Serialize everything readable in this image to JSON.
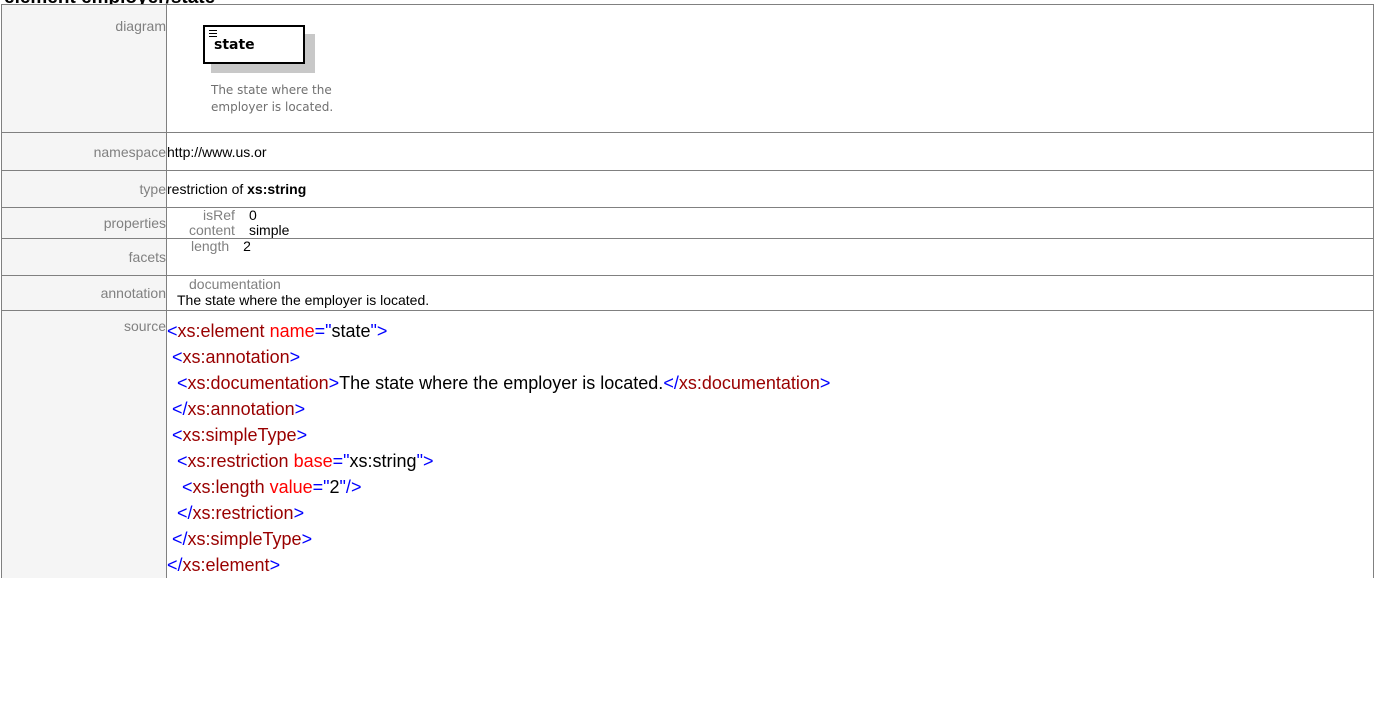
{
  "page": {
    "heading": "element employer/state"
  },
  "rows": {
    "diagram": {
      "label": "diagram",
      "element_name": "state",
      "element_description_line1": "The state where the",
      "element_description_line2": "employer is located."
    },
    "namespace": {
      "label": "namespace",
      "value": "http://www.us.or"
    },
    "type": {
      "label": "type",
      "prefix": "restriction of ",
      "base": "xs:string"
    },
    "properties": {
      "label": "properties",
      "items": [
        {
          "key": "isRef",
          "value": "0"
        },
        {
          "key": "content",
          "value": "simple"
        }
      ]
    },
    "facets": {
      "label": "facets",
      "items": [
        {
          "key": "length",
          "value": "2"
        }
      ]
    },
    "annotation": {
      "label": "annotation",
      "heading": "documentation",
      "text": "The state where the employer is located."
    },
    "source": {
      "label": "source",
      "lines": [
        {
          "indent": "",
          "parts": [
            [
              "t",
              "<"
            ],
            [
              "tn",
              "xs:element"
            ],
            [
              "tx",
              " "
            ],
            [
              "an",
              "name"
            ],
            [
              "t",
              "=\""
            ],
            [
              "tx",
              "state"
            ],
            [
              "t",
              "\">"
            ]
          ]
        },
        {
          "indent": " ",
          "parts": [
            [
              "t",
              "<"
            ],
            [
              "tn",
              "xs:annotation"
            ],
            [
              "t",
              ">"
            ]
          ]
        },
        {
          "indent": "  ",
          "parts": [
            [
              "t",
              "<"
            ],
            [
              "tn",
              "xs:documentation"
            ],
            [
              "t",
              ">"
            ],
            [
              "tx",
              "The state where the employer is located."
            ],
            [
              "t",
              "</"
            ],
            [
              "tn",
              "xs:documentation"
            ],
            [
              "t",
              ">"
            ]
          ]
        },
        {
          "indent": " ",
          "parts": [
            [
              "t",
              "</"
            ],
            [
              "tn",
              "xs:annotation"
            ],
            [
              "t",
              ">"
            ]
          ]
        },
        {
          "indent": " ",
          "parts": [
            [
              "t",
              "<"
            ],
            [
              "tn",
              "xs:simpleType"
            ],
            [
              "t",
              ">"
            ]
          ]
        },
        {
          "indent": "  ",
          "parts": [
            [
              "t",
              "<"
            ],
            [
              "tn",
              "xs:restriction"
            ],
            [
              "tx",
              " "
            ],
            [
              "an",
              "base"
            ],
            [
              "t",
              "=\""
            ],
            [
              "tx",
              "xs:string"
            ],
            [
              "t",
              "\">"
            ]
          ]
        },
        {
          "indent": "   ",
          "parts": [
            [
              "t",
              "<"
            ],
            [
              "tn",
              "xs:length"
            ],
            [
              "tx",
              " "
            ],
            [
              "an",
              "value"
            ],
            [
              "t",
              "=\""
            ],
            [
              "tx",
              "2"
            ],
            [
              "t",
              "\"/>"
            ]
          ]
        },
        {
          "indent": "  ",
          "parts": [
            [
              "t",
              "</"
            ],
            [
              "tn",
              "xs:restriction"
            ],
            [
              "t",
              ">"
            ]
          ]
        },
        {
          "indent": " ",
          "parts": [
            [
              "t",
              "</"
            ],
            [
              "tn",
              "xs:simpleType"
            ],
            [
              "t",
              ">"
            ]
          ]
        },
        {
          "indent": "",
          "parts": [
            [
              "t",
              "</"
            ],
            [
              "tn",
              "xs:element"
            ],
            [
              "t",
              ">"
            ]
          ]
        }
      ]
    }
  },
  "colors": {
    "markup": "#0000ff",
    "tag_name": "#990000",
    "attribute_name": "#ff0000",
    "text": "#000000",
    "label": "#808080"
  }
}
